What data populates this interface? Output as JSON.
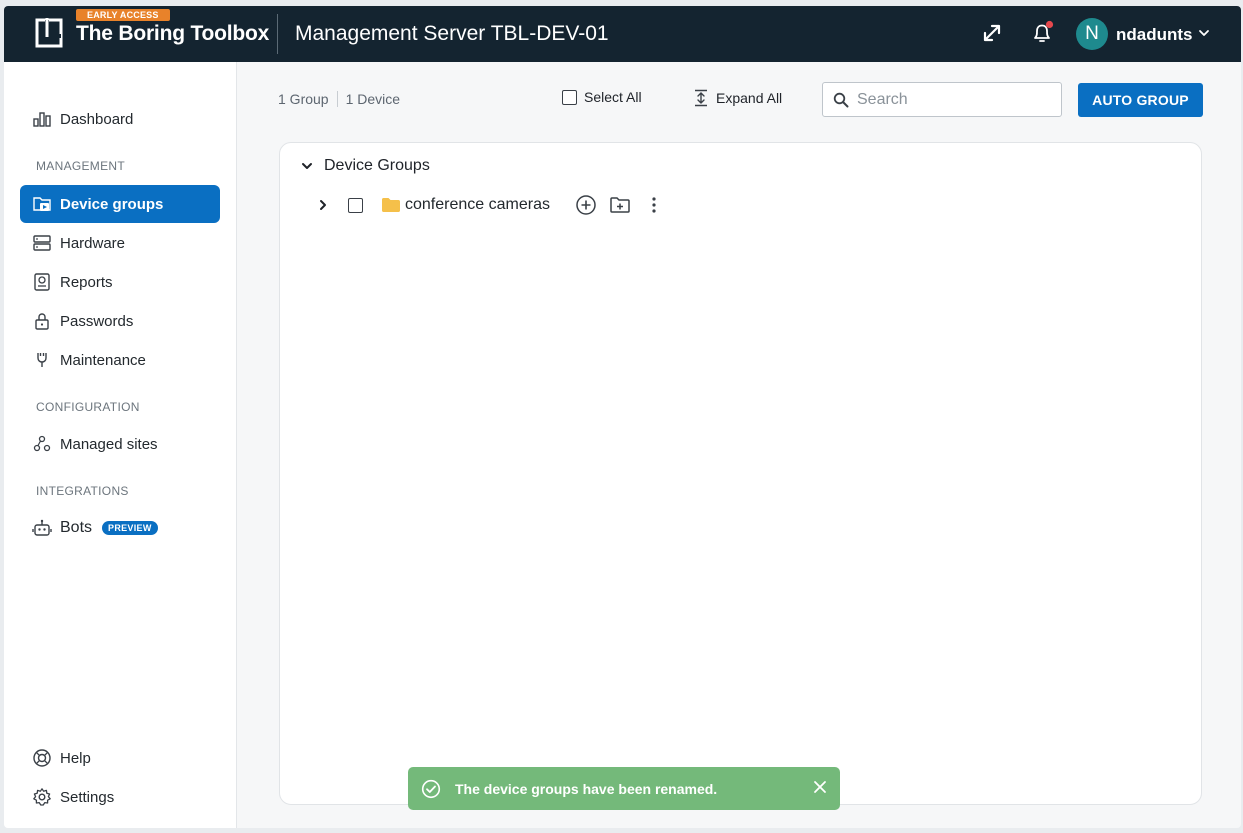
{
  "header": {
    "badge": "EARLY ACCESS",
    "brand": "The Boring Toolbox",
    "server_title": "Management Server TBL-DEV-01",
    "user_initial": "N",
    "username": "ndadunts",
    "colors": {
      "bar": "#142430",
      "badge": "#e8822a",
      "notification_dot": "#e5484d",
      "avatar": "#1e8a8e"
    }
  },
  "sidebar": {
    "dashboard": "Dashboard",
    "section_management": "MANAGEMENT",
    "device_groups": "Device groups",
    "hardware": "Hardware",
    "reports": "Reports",
    "passwords": "Passwords",
    "maintenance": "Maintenance",
    "section_configuration": "CONFIGURATION",
    "managed_sites": "Managed sites",
    "section_integrations": "INTEGRATIONS",
    "bots": "Bots",
    "bots_badge": "PREVIEW",
    "help": "Help",
    "settings": "Settings",
    "active_color": "#0a6fc2"
  },
  "toolbar": {
    "group_count": "1 Group",
    "device_count": "1 Device",
    "select_all": "Select All",
    "expand_all": "Expand All",
    "search_placeholder": "Search",
    "auto_group": "AUTO GROUP"
  },
  "tree": {
    "root_label": "Device Groups",
    "groups": [
      {
        "name": "conference cameras",
        "folder_color": "#f5c04a"
      }
    ]
  },
  "toast": {
    "message": "The device groups have been renamed.",
    "color": "#74b97a"
  }
}
